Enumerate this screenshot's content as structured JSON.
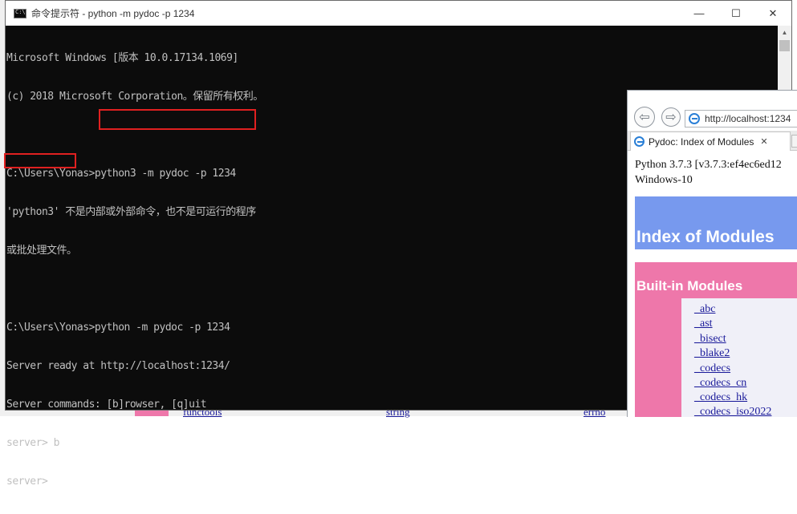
{
  "background_browser": {
    "bottom_links": [
      "functools",
      "string",
      "errno"
    ]
  },
  "console": {
    "title": "命令提示符 - python  -m pydoc -p 1234",
    "window_buttons": {
      "minimize": "—",
      "maximize": "☐",
      "close": "✕"
    },
    "lines": [
      "Microsoft Windows [版本 10.0.17134.1069]",
      "(c) 2018 Microsoft Corporation。保留所有权利。",
      "",
      "C:\\Users\\Yonas>python3 -m pydoc -p 1234",
      "'python3' 不是内部或外部命令，也不是可运行的程序",
      "或批处理文件。",
      "",
      "C:\\Users\\Yonas>python -m pydoc -p 1234",
      "Server ready at http://localhost:1234/",
      "Server commands: [b]rowser, [q]uit",
      "server> b",
      "server>"
    ],
    "highlight_color": "#e02020"
  },
  "browser": {
    "address": "http://localhost:1234",
    "tab_title": "Pydoc: Index of Modules",
    "tab_close": "✕",
    "version_line1": "Python 3.7.3 [v3.7.3:ef4ec6ed12",
    "version_line2": "Windows-10",
    "heading": "Index of Modules",
    "builtin_title": "Built-in Modules",
    "builtin_modules": [
      "_abc",
      "_ast",
      "_bisect",
      "_blake2",
      "_codecs",
      "_codecs_cn",
      "_codecs_hk",
      "_codecs_iso2022"
    ],
    "colors": {
      "heading_bg": "#7799ee",
      "builtin_bg": "#ee77aa",
      "link": "#1a1a9a"
    }
  }
}
